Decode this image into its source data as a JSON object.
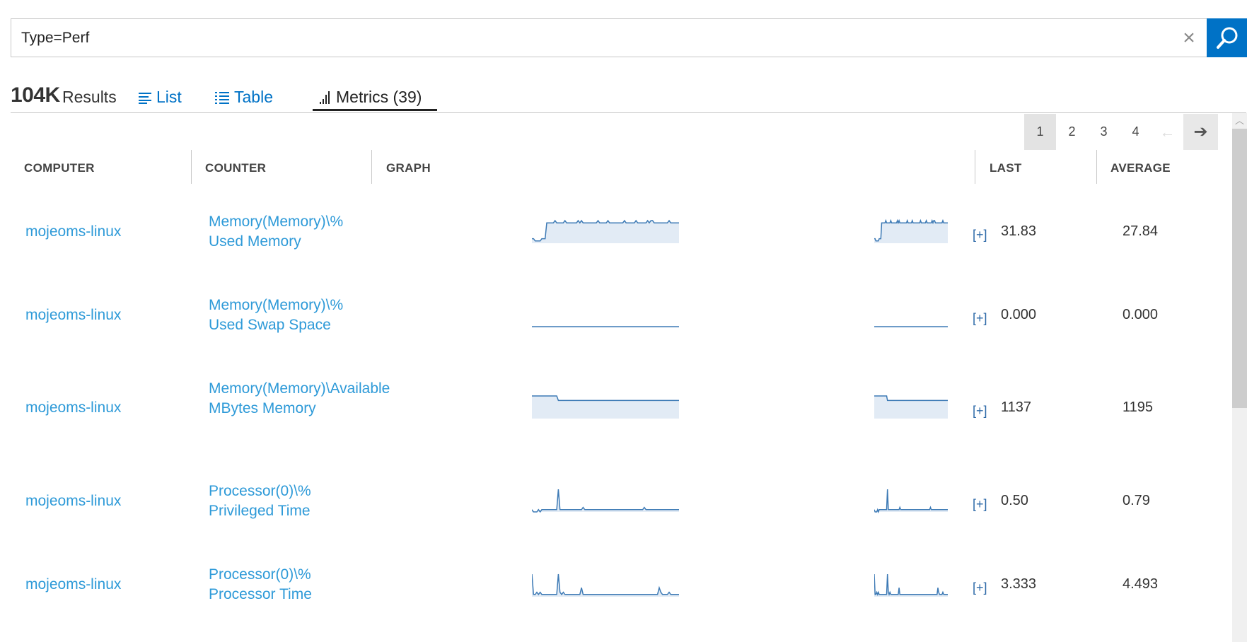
{
  "search": {
    "query": "Type=Perf"
  },
  "results": {
    "count": "104K",
    "label": "Results",
    "tabs": [
      {
        "label": "List",
        "icon": "list-icon"
      },
      {
        "label": "Table",
        "icon": "table-icon"
      },
      {
        "label": "Metrics (39)",
        "icon": "metrics-icon",
        "active": true
      }
    ]
  },
  "pager": {
    "pages": [
      "1",
      "2",
      "3",
      "4"
    ],
    "current": "1",
    "prev": "←",
    "next": "➔"
  },
  "columns": {
    "computer": "COMPUTER",
    "counter": "COUNTER",
    "graph": "GRAPH",
    "last": "LAST",
    "average": "AVERAGE"
  },
  "rows": [
    {
      "computer": "mojeoms-linux",
      "counter": "Memory(Memory)\\% Used Memory",
      "last": "31.83",
      "average": "27.84",
      "expand": "[+]",
      "series": [
        2,
        2,
        1,
        1,
        1,
        1,
        2,
        2,
        2,
        9,
        9,
        9,
        9,
        9,
        10,
        9,
        9,
        9,
        9,
        9,
        10,
        9,
        9,
        9,
        9,
        9,
        9,
        9,
        10,
        9,
        10,
        9,
        9,
        9,
        9,
        9,
        9,
        9,
        9,
        9,
        10,
        9,
        9,
        9,
        9,
        9,
        10,
        9,
        9,
        9,
        9,
        9,
        9,
        9,
        9,
        9,
        10,
        9,
        9,
        9,
        9,
        9,
        9,
        10,
        9,
        9,
        9,
        9,
        9,
        9,
        10,
        9,
        10,
        10,
        9,
        9,
        9,
        9,
        9,
        9,
        9,
        9,
        9,
        10,
        9,
        9,
        9,
        9,
        9,
        9
      ],
      "fill": true
    },
    {
      "computer": "mojeoms-linux",
      "counter": "Memory(Memory)\\% Used Swap Space",
      "last": "0.000",
      "average": "0.000",
      "expand": "[+]",
      "series": [
        0,
        0,
        0,
        0,
        0,
        0,
        0,
        0,
        0,
        0,
        0,
        0,
        0,
        0,
        0,
        0,
        0,
        0,
        0,
        0,
        0,
        0,
        0,
        0,
        0,
        0,
        0,
        0,
        0,
        0,
        0,
        0,
        0,
        0,
        0,
        0,
        0,
        0,
        0,
        0,
        0,
        0,
        0,
        0,
        0,
        0,
        0,
        0,
        0,
        0,
        0,
        0,
        0,
        0,
        0,
        0,
        0,
        0,
        0,
        0,
        0,
        0,
        0,
        0,
        0,
        0,
        0,
        0,
        0,
        0,
        0,
        0,
        0,
        0,
        0,
        0,
        0,
        0,
        0,
        0
      ],
      "fill": false
    },
    {
      "computer": "mojeoms-linux",
      "counter": "Memory(Memory)\\Available MBytes Memory",
      "last": "1137",
      "average": "1195",
      "expand": "[+]",
      "series": [
        10,
        10,
        10,
        10,
        10,
        10,
        10,
        10,
        10,
        10,
        10,
        10,
        10,
        10,
        10,
        10,
        8,
        8,
        8,
        8,
        8,
        8,
        8,
        8,
        8,
        8,
        8,
        8,
        8,
        8,
        8,
        8,
        8,
        8,
        8,
        8,
        8,
        8,
        8,
        8,
        8,
        8,
        8,
        8,
        8,
        8,
        8,
        8,
        8,
        8,
        8,
        8,
        8,
        8,
        8,
        8,
        8,
        8,
        8,
        8,
        8,
        8,
        8,
        8,
        8,
        8,
        8,
        8,
        8,
        8,
        8,
        8,
        8,
        8,
        8,
        8,
        8,
        8,
        8,
        8,
        8,
        8,
        8,
        8,
        8,
        8,
        8,
        8,
        8,
        8
      ],
      "fill": true
    },
    {
      "computer": "mojeoms-linux",
      "counter": "Processor(0)\\% Privileged Time",
      "last": "0.50",
      "average": "0.79",
      "expand": "[+]",
      "series": [
        1,
        0,
        0,
        0,
        1,
        0,
        1,
        1,
        1,
        1,
        1,
        1,
        1,
        1,
        1,
        1,
        10,
        1,
        1,
        1,
        1,
        1,
        1,
        1,
        1,
        1,
        1,
        1,
        1,
        1,
        1,
        2,
        1,
        1,
        1,
        1,
        1,
        1,
        1,
        1,
        1,
        1,
        1,
        1,
        1,
        1,
        1,
        1,
        1,
        1,
        1,
        1,
        1,
        1,
        1,
        1,
        1,
        1,
        1,
        1,
        1,
        1,
        1,
        1,
        1,
        1,
        1,
        1,
        2,
        1,
        1,
        1,
        1,
        1,
        1,
        1,
        1,
        1,
        1,
        1,
        1,
        1,
        1,
        1,
        1,
        1,
        1,
        1,
        1,
        1
      ],
      "fill": true
    },
    {
      "computer": "mojeoms-linux",
      "counter": "Processor(0)\\% Processor Time",
      "last": "3.333",
      "average": "4.493",
      "expand": "[+]",
      "series": [
        10,
        1,
        1,
        2,
        1,
        2,
        1,
        1,
        1,
        1,
        1,
        1,
        1,
        1,
        1,
        1,
        10,
        2,
        1,
        2,
        1,
        1,
        1,
        1,
        1,
        1,
        1,
        1,
        1,
        1,
        4,
        1,
        1,
        1,
        1,
        1,
        1,
        1,
        1,
        1,
        1,
        1,
        1,
        1,
        1,
        1,
        1,
        1,
        1,
        1,
        1,
        1,
        1,
        1,
        1,
        1,
        1,
        1,
        1,
        1,
        1,
        1,
        1,
        1,
        1,
        1,
        1,
        1,
        1,
        1,
        1,
        1,
        1,
        1,
        1,
        1,
        1,
        4,
        2,
        1,
        1,
        1,
        1,
        2,
        1,
        1,
        1,
        1,
        1,
        1
      ],
      "fill": true
    }
  ],
  "colors": {
    "accent": "#0072c6",
    "link": "#2e9ad8",
    "spark_line": "#3d7ab5",
    "spark_fill": "#e2ebf5"
  }
}
